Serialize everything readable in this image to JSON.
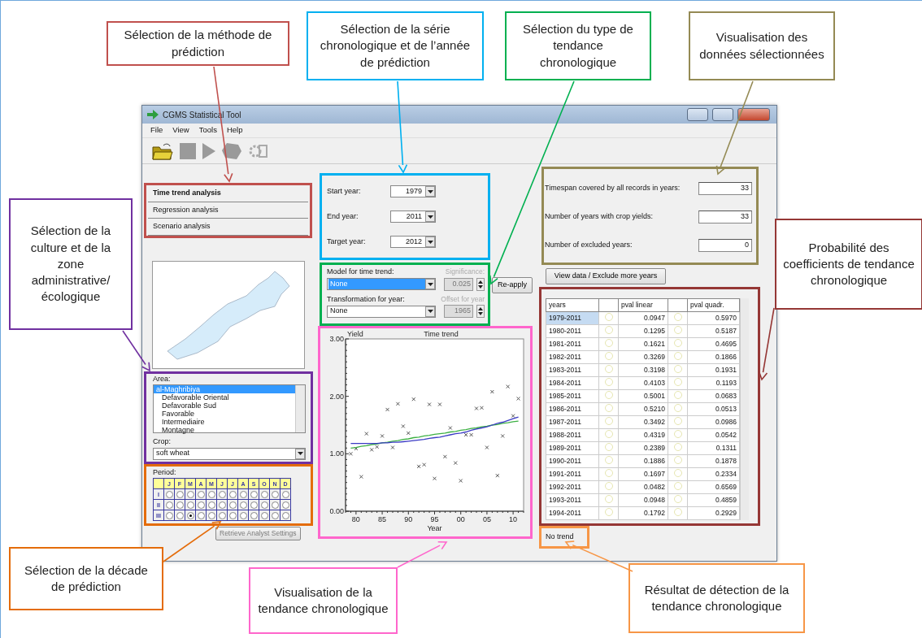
{
  "window": {
    "title": "CGMS Statistical Tool"
  },
  "menu": [
    "File",
    "View",
    "Tools",
    "Help"
  ],
  "analysis_tabs": [
    {
      "label": "Time trend analysis",
      "selected": true
    },
    {
      "label": "Regression analysis",
      "selected": false
    },
    {
      "label": "Scenario analysis",
      "selected": false
    }
  ],
  "area": {
    "label": "Area:",
    "items": [
      {
        "label": "al-Maghribiya",
        "selected": true
      },
      {
        "label": "Defavorable Oriental",
        "selected": false
      },
      {
        "label": "Defavorable Sud",
        "selected": false
      },
      {
        "label": "Favorable",
        "selected": false
      },
      {
        "label": "Intermediaire",
        "selected": false
      },
      {
        "label": "Montagne",
        "selected": false
      }
    ]
  },
  "crop": {
    "label": "Crop:",
    "value": "soft wheat"
  },
  "period": {
    "label": "Period:",
    "months": [
      "J",
      "F",
      "M",
      "A",
      "M",
      "J",
      "J",
      "A",
      "S",
      "O",
      "N",
      "D"
    ],
    "rows": [
      {
        "label": "I",
        "selected": [
          false,
          false,
          false,
          false,
          false,
          false,
          false,
          false,
          false,
          false,
          false,
          false
        ]
      },
      {
        "label": "II",
        "selected": [
          false,
          false,
          false,
          false,
          false,
          false,
          false,
          false,
          false,
          false,
          false,
          false
        ]
      },
      {
        "label": "III",
        "selected": [
          false,
          false,
          true,
          false,
          false,
          false,
          false,
          false,
          false,
          false,
          false,
          false
        ]
      }
    ]
  },
  "retrieve_button": {
    "label": "Retrieve Analyst Settings",
    "disabled": true
  },
  "years": [
    {
      "label": "Start year:",
      "value": "1979"
    },
    {
      "label": "End year:",
      "value": "2011"
    },
    {
      "label": "Target year:",
      "value": "2012"
    }
  ],
  "trend": {
    "combos": [
      {
        "label": "Model for time trend:",
        "value": "None",
        "focused": true
      },
      {
        "label": "Transformation for year:",
        "value": "None",
        "focused": false
      }
    ],
    "spinners": [
      {
        "label": "Significance:",
        "value": "0.025",
        "disabled": true
      },
      {
        "label": "Offset for year",
        "value": "1965",
        "disabled": true
      }
    ],
    "reapply": "Re-apply"
  },
  "chart": {
    "chart_data": {
      "type": "scatter",
      "title": "Time trend",
      "xlabel": "Year",
      "ylabel": "Yield",
      "x": [
        1979,
        1980,
        1981,
        1982,
        1983,
        1984,
        1985,
        1986,
        1987,
        1988,
        1989,
        1990,
        1991,
        1992,
        1993,
        1994,
        1995,
        1996,
        1997,
        1998,
        1999,
        2000,
        2001,
        2002,
        2003,
        2004,
        2005,
        2006,
        2007,
        2008,
        2009,
        2010,
        2011
      ],
      "series": [
        {
          "type": "scatter",
          "color": "#555555",
          "values": [
            1.0,
            1.09,
            0.6,
            1.35,
            1.07,
            1.12,
            1.31,
            1.77,
            1.11,
            1.87,
            1.48,
            1.36,
            1.95,
            0.78,
            0.81,
            1.86,
            0.57,
            1.86,
            0.95,
            1.45,
            0.84,
            0.53,
            1.33,
            1.33,
            1.79,
            1.8,
            1.11,
            2.08,
            0.62,
            1.31,
            2.17,
            1.66,
            1.96
          ]
        },
        {
          "type": "line",
          "color": "#3cb043",
          "values": [
            1.1,
            1.11,
            1.13,
            1.14,
            1.16,
            1.17,
            1.19,
            1.2,
            1.22,
            1.23,
            1.25,
            1.26,
            1.28,
            1.29,
            1.31,
            1.32,
            1.34,
            1.35,
            1.36,
            1.38,
            1.39,
            1.41,
            1.42,
            1.44,
            1.45,
            1.47,
            1.48,
            1.5,
            1.51,
            1.53,
            1.54,
            1.56,
            1.57
          ]
        },
        {
          "type": "line",
          "color": "#3b3bc4",
          "values": [
            1.18,
            1.18,
            1.18,
            1.18,
            1.18,
            1.18,
            1.19,
            1.19,
            1.2,
            1.2,
            1.21,
            1.22,
            1.23,
            1.24,
            1.25,
            1.27,
            1.28,
            1.29,
            1.31,
            1.33,
            1.35,
            1.36,
            1.38,
            1.41,
            1.43,
            1.45,
            1.47,
            1.5,
            1.53,
            1.55,
            1.58,
            1.61,
            1.64
          ]
        }
      ],
      "xlim": [
        1978,
        2012
      ],
      "ylim": [
        0,
        3
      ],
      "xticks": [
        {
          "value": 1980,
          "label": "80"
        },
        {
          "value": 1985,
          "label": "85"
        },
        {
          "value": 1990,
          "label": "90"
        },
        {
          "value": 1995,
          "label": "95"
        },
        {
          "value": 2000,
          "label": "00"
        },
        {
          "value": 2005,
          "label": "05"
        },
        {
          "value": 2010,
          "label": "10"
        }
      ],
      "yticks": [
        {
          "value": 0,
          "label": "0.00"
        },
        {
          "value": 1,
          "label": "1.00"
        },
        {
          "value": 2,
          "label": "2.00"
        },
        {
          "value": 3,
          "label": "3.00"
        }
      ]
    }
  },
  "stats": [
    {
      "label": "Timespan covered by all records in years:",
      "value": "33"
    },
    {
      "label": "Number of years with crop yields:",
      "value": "33"
    },
    {
      "label": "Number of excluded years:",
      "value": "0"
    }
  ],
  "view_button": "View data / Exclude more years",
  "table": {
    "columns": [
      "years",
      "pval linear",
      "pval quadr."
    ],
    "rows": [
      {
        "years": "1979-2011",
        "pval_linear": "0.0947",
        "pval_quadr": "0.5970",
        "selected": true
      },
      {
        "years": "1980-2011",
        "pval_linear": "0.1295",
        "pval_quadr": "0.5187",
        "selected": false
      },
      {
        "years": "1981-2011",
        "pval_linear": "0.1621",
        "pval_quadr": "0.4695",
        "selected": false
      },
      {
        "years": "1982-2011",
        "pval_linear": "0.3269",
        "pval_quadr": "0.1866",
        "selected": false
      },
      {
        "years": "1983-2011",
        "pval_linear": "0.3198",
        "pval_quadr": "0.1931",
        "selected": false
      },
      {
        "years": "1984-2011",
        "pval_linear": "0.4103",
        "pval_quadr": "0.1193",
        "selected": false
      },
      {
        "years": "1985-2011",
        "pval_linear": "0.5001",
        "pval_quadr": "0.0683",
        "selected": false
      },
      {
        "years": "1986-2011",
        "pval_linear": "0.5210",
        "pval_quadr": "0.0513",
        "selected": false
      },
      {
        "years": "1987-2011",
        "pval_linear": "0.3492",
        "pval_quadr": "0.0986",
        "selected": false
      },
      {
        "years": "1988-2011",
        "pval_linear": "0.4319",
        "pval_quadr": "0.0542",
        "selected": false
      },
      {
        "years": "1989-2011",
        "pval_linear": "0.2389",
        "pval_quadr": "0.1311",
        "selected": false
      },
      {
        "years": "1990-2011",
        "pval_linear": "0.1886",
        "pval_quadr": "0.1878",
        "selected": false
      },
      {
        "years": "1991-2011",
        "pval_linear": "0.1697",
        "pval_quadr": "0.2334",
        "selected": false
      },
      {
        "years": "1992-2011",
        "pval_linear": "0.0482",
        "pval_quadr": "0.6569",
        "selected": false
      },
      {
        "years": "1993-2011",
        "pval_linear": "0.0948",
        "pval_quadr": "0.4859",
        "selected": false
      },
      {
        "years": "1994-2011",
        "pval_linear": "0.1792",
        "pval_quadr": "0.2929",
        "selected": false
      }
    ]
  },
  "trend_result": "No trend",
  "annotations": [
    {
      "text": "Sélection de la méthode de prédiction",
      "color": "#c0504d"
    },
    {
      "text": "Sélection de la série chronologique et de l’année de prédiction",
      "color": "#00b0f0"
    },
    {
      "text": "Sélection du type de tendance chronologique",
      "color": "#00b050"
    },
    {
      "text": "Visualisation des données sélectionnées",
      "color": "#948a54"
    },
    {
      "text": "Sélection de la culture et de la zone administrative/ écologique",
      "color": "#7030a0"
    },
    {
      "text": "Probabilité des coefficients de tendance chronologique",
      "color": "#953735"
    },
    {
      "text": "Sélection de la décade de prédiction",
      "color": "#e46c0a"
    },
    {
      "text": "Visualisation de la tendance chronologique",
      "color": "#ff66cc"
    },
    {
      "text": "Résultat de détection de la tendance chronologique",
      "color": "#f79646"
    }
  ]
}
